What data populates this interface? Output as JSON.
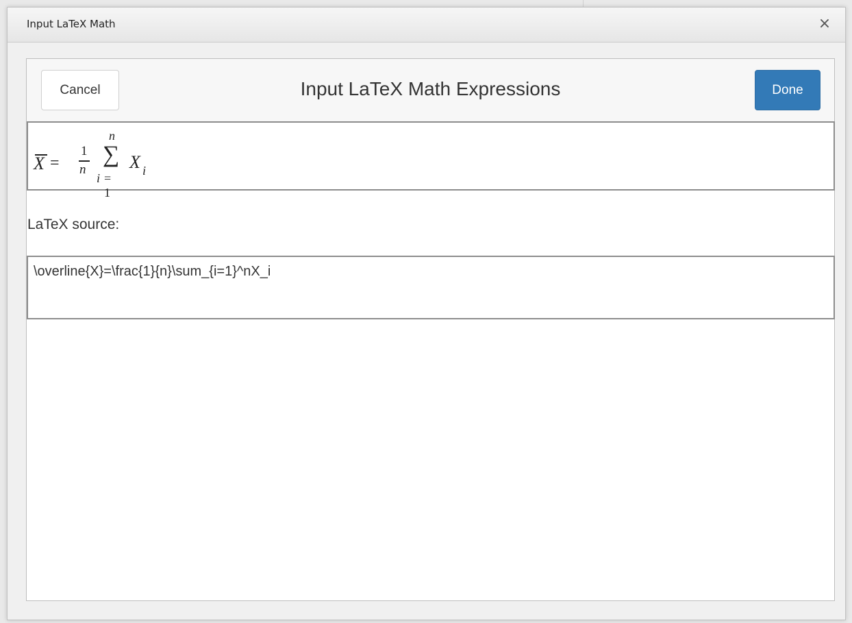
{
  "dialog": {
    "title": "Input LaTeX Math",
    "close_label": "×"
  },
  "toolbar": {
    "cancel_label": "Cancel",
    "title": "Input LaTeX Math Expressions",
    "done_label": "Done"
  },
  "preview": {
    "x_symbol": "X",
    "equals": "=",
    "frac_numerator": "1",
    "frac_denominator": "n",
    "sum_symbol": "∑",
    "sum_upper": "n",
    "sum_lower_var": "i",
    "sum_lower_eq": "= 1",
    "term": "X",
    "term_subscript": "i"
  },
  "source": {
    "label": "LaTeX source:",
    "value": "\\overline{X}=\\frac{1}{n}\\sum_{i=1}^nX_i"
  },
  "colors": {
    "primary_button": "#337ab7",
    "dialog_background": "#f0f0f0"
  }
}
